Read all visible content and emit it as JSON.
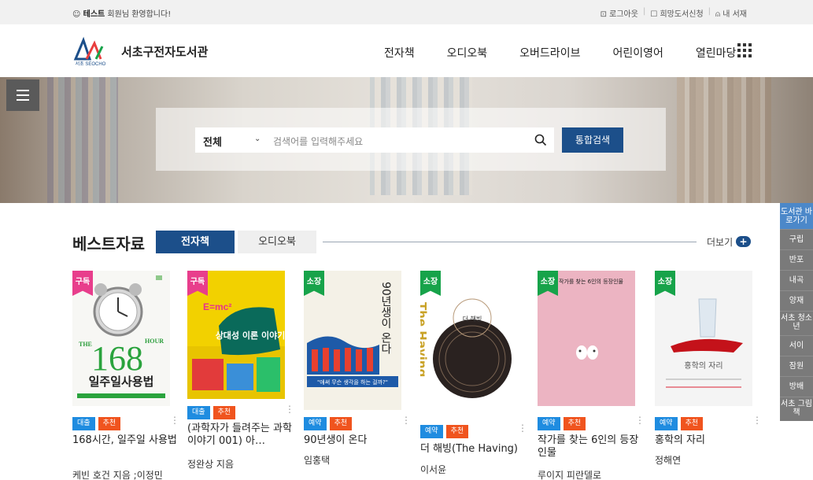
{
  "topbar": {
    "welcome_icon": "☺",
    "welcome_user": "테스트",
    "welcome_text": "회원님 환영합니다!",
    "logout": "⊡ 로그아웃",
    "request": "☐ 희망도서신청",
    "mylib": "⍝ 내 서재"
  },
  "header": {
    "logo_text": "서초 SEOCHO",
    "title": "서초구전자도서관",
    "nav": [
      "전자책",
      "오디오북",
      "오버드라이브",
      "어린이영어",
      "열린마당"
    ]
  },
  "search": {
    "scope": "전체",
    "placeholder": "검색어를 입력해주세요",
    "button": "통합검색"
  },
  "quick": {
    "head": "도서관 바로가기",
    "items": [
      "구립",
      "반포",
      "내곡",
      "양재",
      "서초 청소년",
      "서이",
      "잠원",
      "방배",
      "서초 그림책"
    ]
  },
  "best": {
    "title": "베스트자료",
    "tab_ebook": "전자책",
    "tab_audio": "오디오북",
    "more": "더보기",
    "more_icon": "+",
    "books": [
      {
        "ribbon": "구독",
        "badges": [
          "대출",
          "추천"
        ],
        "title": "168시간, 일주일 사용법",
        "author": "케빈 호건 지음 ;이정민"
      },
      {
        "ribbon": "구독",
        "badges": [
          "대출",
          "추천"
        ],
        "title": "(과학자가 들려주는 과학 이야기 001) 아…",
        "author": "정완상 지음"
      },
      {
        "ribbon": "소장",
        "badges": [
          "예약",
          "추천"
        ],
        "title": "90년생이 온다",
        "author": "임홍택"
      },
      {
        "ribbon": "소장",
        "badges": [
          "예약",
          "추천"
        ],
        "title": "더 해빙(The Having)",
        "author": "이서윤"
      },
      {
        "ribbon": "소장",
        "badges": [
          "예약",
          "추천"
        ],
        "title": "작가를 찾는 6인의 등장인물",
        "author": "루이지 피란델로"
      },
      {
        "ribbon": "소장",
        "badges": [
          "예약",
          "추천"
        ],
        "title": "홍학의 자리",
        "author": "정해연"
      }
    ],
    "cover_text": {
      "b1_big": "168",
      "b1_hour": "HOUR",
      "b1_the": "THE",
      "b1_sub": "일주일사용법",
      "b2_title": "상대성 이론 이야기",
      "b2_emc": "E=mc²",
      "b3_title": "90년생이 온다",
      "b3_quote": "\"애써 무슨 생각을 하는 걸까?\"",
      "b4_side": "The Having",
      "b4_title": "더 해빙",
      "b5_title": "작가를 찾는 6인의 등장인물",
      "b6_title": "홍학의 자리"
    }
  }
}
